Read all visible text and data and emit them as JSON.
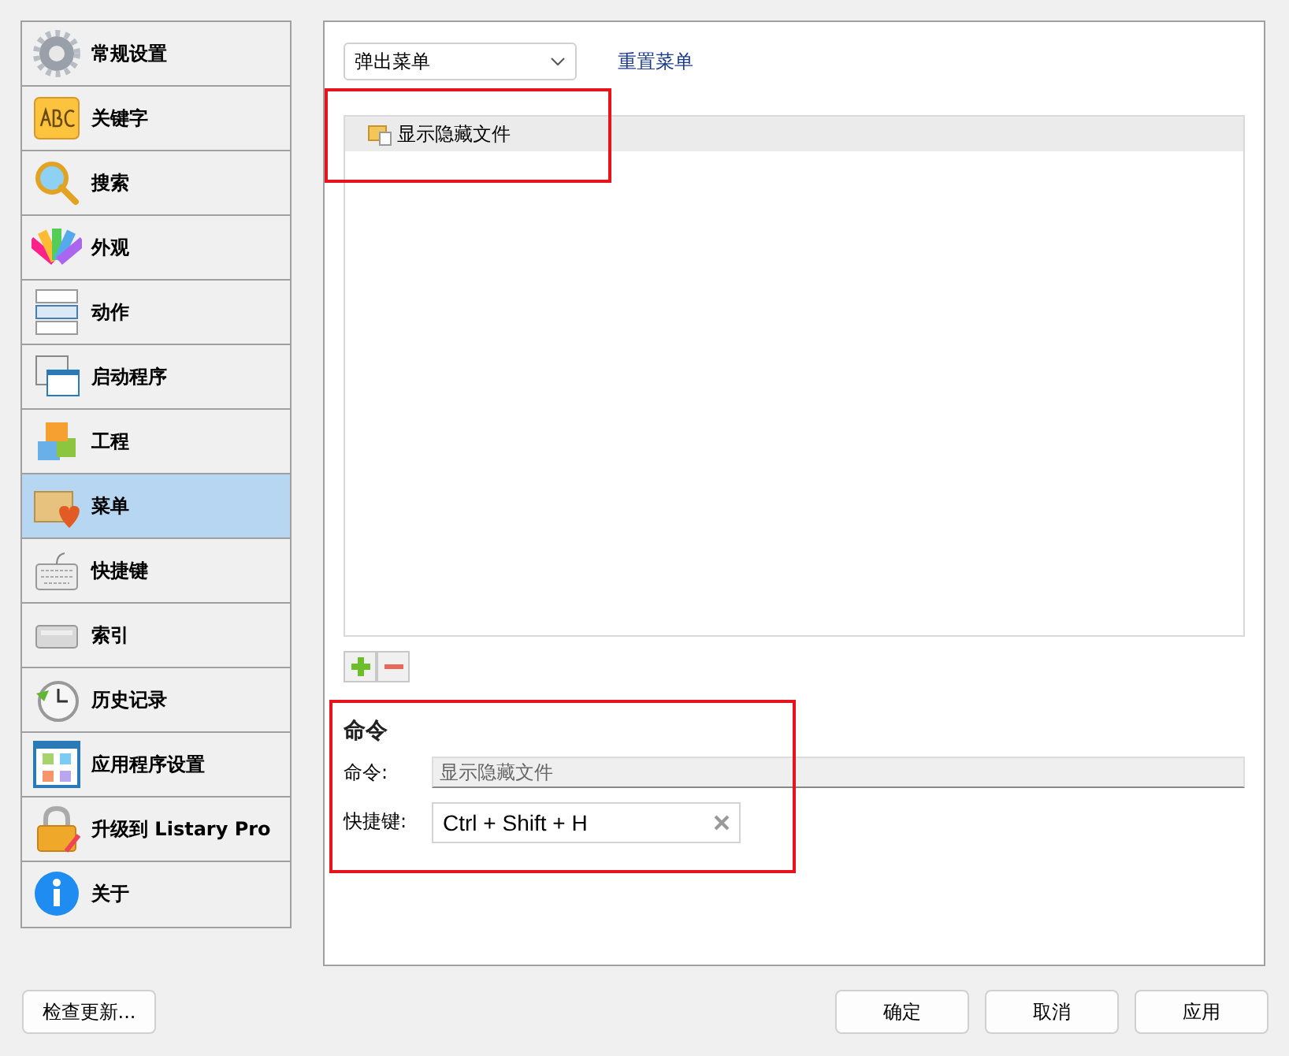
{
  "sidebar": {
    "items": [
      {
        "label": "常规设置",
        "selected": false
      },
      {
        "label": "关键字",
        "selected": false
      },
      {
        "label": "搜索",
        "selected": false
      },
      {
        "label": "外观",
        "selected": false
      },
      {
        "label": "动作",
        "selected": false
      },
      {
        "label": "启动程序",
        "selected": false
      },
      {
        "label": "工程",
        "selected": false
      },
      {
        "label": "菜单",
        "selected": true
      },
      {
        "label": "快捷键",
        "selected": false
      },
      {
        "label": "索引",
        "selected": false
      },
      {
        "label": "历史记录",
        "selected": false
      },
      {
        "label": "应用程序设置",
        "selected": false
      },
      {
        "label": "升级到 Listary Pro",
        "selected": false
      },
      {
        "label": "关于",
        "selected": false
      }
    ]
  },
  "menu_select": {
    "value": "弹出菜单"
  },
  "reset_link": "重置菜单",
  "menu_list": {
    "items": [
      {
        "label": "显示隐藏文件",
        "selected": true
      }
    ]
  },
  "command_section": {
    "title": "命令",
    "command_label": "命令:",
    "command_value": "显示隐藏文件",
    "command_disabled": true,
    "shortcut_label": "快捷键:",
    "shortcut_value": "Ctrl + Shift + H"
  },
  "check_update_button": "检查更新...",
  "buttons": [
    "确定",
    "取消",
    "应用"
  ]
}
